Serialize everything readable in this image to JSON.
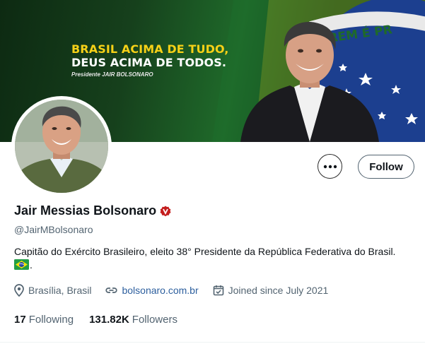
{
  "banner": {
    "line1": "BRASIL ACIMA DE TUDO,",
    "line2": "DEUS ACIMA DE TODOS.",
    "credit": "Presidente JAIR BOLSONARO",
    "flag_motto": "REM É PR",
    "colors": {
      "green": "#1f6a2a",
      "yellow": "#f7d117",
      "blue": "#1c3f8f"
    }
  },
  "profile": {
    "display_name": "Jair Messias Bolsonaro",
    "handle": "@JairMBolsonaro",
    "bio": "Capitão do Exército Brasileiro, eleito 38° Presidente da República Federativa do Brasil.",
    "bio_suffix": ".",
    "verified_badge_color": "#c41e1e"
  },
  "actions": {
    "more_icon": "ellipsis-icon",
    "follow_label": "Follow"
  },
  "meta": {
    "location": "Brasília, Brasil",
    "website": "bolsonaro.com.br",
    "joined": "Joined since July 2021"
  },
  "stats": {
    "following_count": "17",
    "following_label": "Following",
    "followers_count": "131.82K",
    "followers_label": "Followers"
  }
}
